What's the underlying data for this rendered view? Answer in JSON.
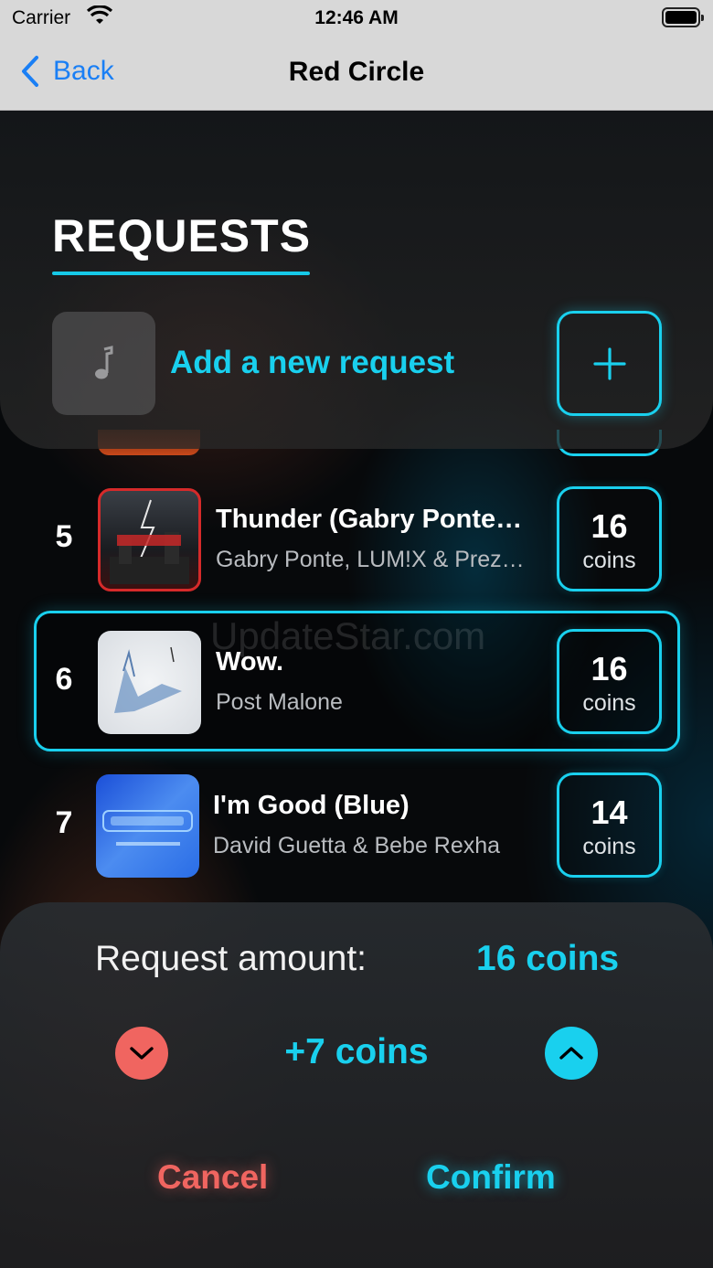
{
  "status_bar": {
    "carrier": "Carrier",
    "time": "12:46 AM"
  },
  "nav": {
    "back_label": "Back",
    "title": "Red Circle"
  },
  "requests": {
    "title": "REQUESTS",
    "add_label": "Add a new request"
  },
  "songs": [
    {
      "rank": "5",
      "title": "Thunder (Gabry Ponte…",
      "artist": "Gabry Ponte, LUM!X & Prez…",
      "coins": "16",
      "coins_unit": "coins"
    },
    {
      "rank": "6",
      "title": "Wow.",
      "artist": "Post Malone",
      "coins": "16",
      "coins_unit": "coins"
    },
    {
      "rank": "7",
      "title": "I'm Good (Blue)",
      "artist": "David Guetta & Bebe Rexha",
      "coins": "14",
      "coins_unit": "coins"
    }
  ],
  "watermark": "UpdateStar.com",
  "sheet": {
    "amount_label": "Request amount:",
    "amount_value": "16 coins",
    "step_value": "+7 coins",
    "cancel_label": "Cancel",
    "confirm_label": "Confirm"
  },
  "colors": {
    "accent": "#19d0ee",
    "danger": "#f06560",
    "link": "#1a7ff5"
  }
}
